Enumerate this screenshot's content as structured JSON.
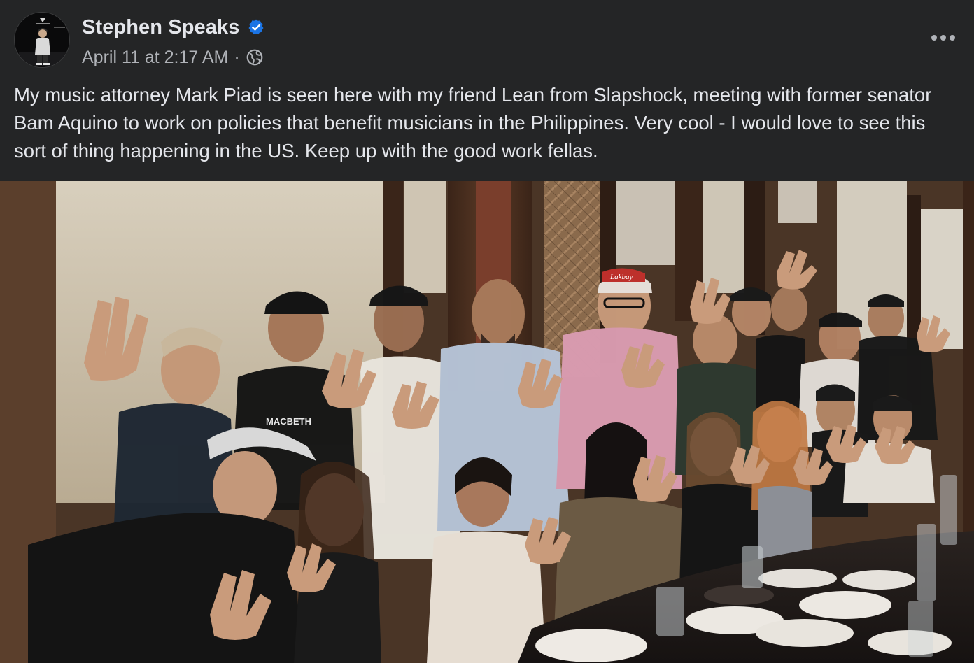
{
  "post": {
    "author": {
      "name": "Stephen Speaks",
      "verified": true,
      "avatar_icon": "profile-avatar"
    },
    "timestamp": "April 11 at 2:17 AM",
    "separator": "·",
    "audience_icon": "globe-icon",
    "more_icon": "more-options-icon",
    "caption": "My music attorney Mark Piad is seen here with my friend Lean from Slapshock, meeting with former senator Bam Aquino to work on policies that benefit musicians in the Philippines. Very cool - I would love to see this sort of thing happening in the US. Keep up with the good work fellas.",
    "photo": {
      "shirt_text": "MACBETH",
      "cap_text": "Lakbay"
    }
  },
  "colors": {
    "background": "#242526",
    "primary_text": "#e4e6eb",
    "secondary_text": "#b0b3b8",
    "verified_blue": "#1b74e4"
  }
}
